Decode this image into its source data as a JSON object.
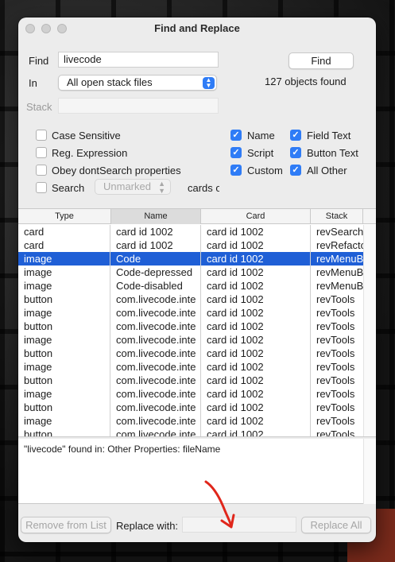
{
  "window": {
    "title": "Find and Replace"
  },
  "find": {
    "label": "Find",
    "value": "livecode",
    "button_label": "Find",
    "status": "127 objects found"
  },
  "in": {
    "label": "In",
    "selected": "All open stack files"
  },
  "stack": {
    "label": "Stack",
    "value": ""
  },
  "options": {
    "case_sensitive": {
      "label": "Case Sensitive",
      "checked": false
    },
    "reg_expression": {
      "label": "Reg. Expression",
      "checked": false
    },
    "obey_dontsearch": {
      "label": "Obey dontSearch properties",
      "checked": false
    },
    "search": {
      "label": "Search",
      "checked": false,
      "popup": "Unmarked",
      "suffix": "cards o"
    }
  },
  "scopes": {
    "name": {
      "label": "Name",
      "checked": true
    },
    "script": {
      "label": "Script",
      "checked": true
    },
    "custom": {
      "label": "Custom",
      "checked": true
    },
    "field_text": {
      "label": "Field Text",
      "checked": true
    },
    "button_text": {
      "label": "Button Text",
      "checked": true
    },
    "all_other": {
      "label": "All Other",
      "checked": true
    }
  },
  "table": {
    "columns": [
      "Type",
      "Name",
      "Card",
      "Stack"
    ],
    "rows": [
      [
        "card",
        "card id 1002",
        "card id 1002",
        "revSearch"
      ],
      [
        "card",
        "card id 1002",
        "card id 1002",
        "revRefacto"
      ],
      [
        "image",
        "Code",
        "card id 1002",
        "revMenuB"
      ],
      [
        "image",
        "Code-depressed",
        "card id 1002",
        "revMenuB"
      ],
      [
        "image",
        "Code-disabled",
        "card id 1002",
        "revMenuB"
      ],
      [
        "button",
        "com.livecode.inte",
        "card id 1002",
        "revTools"
      ],
      [
        "image",
        "com.livecode.inte",
        "card id 1002",
        "revTools"
      ],
      [
        "button",
        "com.livecode.inte",
        "card id 1002",
        "revTools"
      ],
      [
        "image",
        "com.livecode.inte",
        "card id 1002",
        "revTools"
      ],
      [
        "button",
        "com.livecode.inte",
        "card id 1002",
        "revTools"
      ],
      [
        "image",
        "com.livecode.inte",
        "card id 1002",
        "revTools"
      ],
      [
        "button",
        "com.livecode.inte",
        "card id 1002",
        "revTools"
      ],
      [
        "image",
        "com.livecode.inte",
        "card id 1002",
        "revTools"
      ],
      [
        "button",
        "com.livecode.inte",
        "card id 1002",
        "revTools"
      ],
      [
        "image",
        "com.livecode.inte",
        "card id 1002",
        "revTools"
      ],
      [
        "button",
        "com.livecode.inte",
        "card id 1002",
        "revTools"
      ]
    ],
    "selected_row": 2
  },
  "results_text": "\"livecode\" found in: Other Properties: fileName",
  "footer": {
    "remove_label": "Remove from List",
    "replace_with_label": "Replace with:",
    "replace_value": "",
    "replace_all_label": "Replace All"
  },
  "colors": {
    "accent": "#2f7cf6",
    "selection": "#1f5fd6",
    "annotation_arrow": "#e0261b"
  }
}
